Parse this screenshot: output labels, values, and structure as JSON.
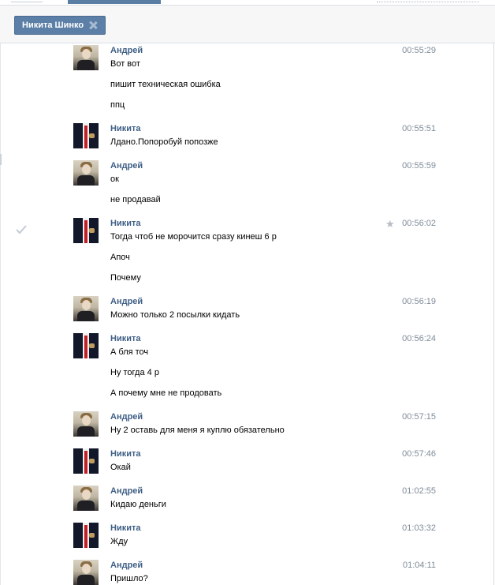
{
  "header": {
    "chip_label": "Никита Шинко"
  },
  "messages": [
    {
      "sender": "Андрей",
      "time": "00:55:29",
      "lines": [
        "Вот вот",
        "пишит техническая ошибка",
        "ппц"
      ]
    },
    {
      "sender": "Никита",
      "time": "00:55:51",
      "lines": [
        "Лдано.Попоробуй попозже"
      ]
    },
    {
      "sender": "Андрей",
      "time": "00:55:59",
      "lines": [
        "ок",
        "не продавай"
      ]
    },
    {
      "sender": "Никита",
      "time": "00:56:02",
      "lines": [
        "Тогда чтоб не морочится сразу кинеш 6 р",
        "Апоч",
        "Почему"
      ]
    },
    {
      "sender": "Андрей",
      "time": "00:56:19",
      "lines": [
        "Можно только 2 посылки кидать"
      ]
    },
    {
      "sender": "Никита",
      "time": "00:56:24",
      "lines": [
        "А бля точ",
        "Ну тогда 4 р",
        "А почему мне не продовать"
      ]
    },
    {
      "sender": "Андрей",
      "time": "00:57:15",
      "lines": [
        "Ну 2 оставь для меня я куплю обязательно"
      ]
    },
    {
      "sender": "Никита",
      "time": "00:57:46",
      "lines": [
        "Окай"
      ]
    },
    {
      "sender": "Андрей",
      "time": "01:02:55",
      "lines": [
        "Кидаю деньги"
      ]
    },
    {
      "sender": "Никита",
      "time": "01:03:32",
      "lines": [
        "Жду"
      ]
    },
    {
      "sender": "Андрей",
      "time": "01:04:11",
      "lines": [
        "Пришло?"
      ]
    }
  ]
}
